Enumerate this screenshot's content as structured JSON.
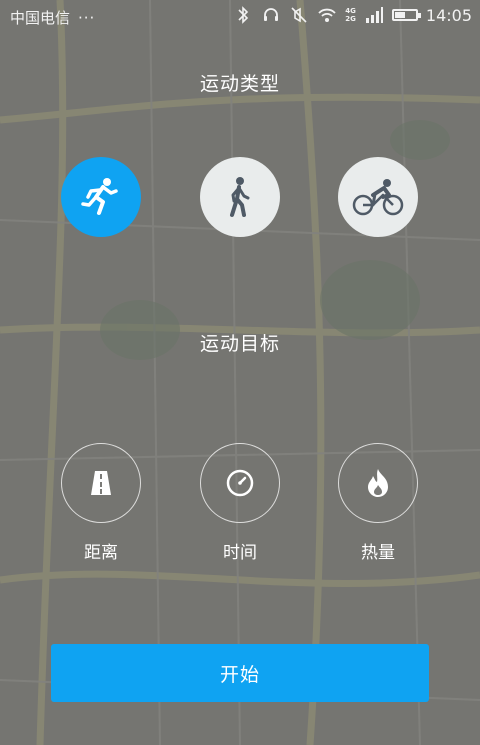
{
  "status_bar": {
    "carrier": "中国电信",
    "dots": "···",
    "network_top": "4G",
    "network_bottom": "2G",
    "time": "14:05",
    "battery_level": 0.55
  },
  "sport_type": {
    "title": "运动类型",
    "options": [
      {
        "icon": "running-icon",
        "selected": true
      },
      {
        "icon": "walking-icon",
        "selected": false
      },
      {
        "icon": "cycling-icon",
        "selected": false
      }
    ]
  },
  "sport_goal": {
    "title": "运动目标",
    "options": [
      {
        "icon": "road-icon",
        "label": "距离"
      },
      {
        "icon": "clock-icon",
        "label": "时间"
      },
      {
        "icon": "flame-icon",
        "label": "热量"
      }
    ]
  },
  "start_button": {
    "label": "开始"
  },
  "colors": {
    "accent": "#0fa3f2",
    "inactive_circle": "#e9ecec",
    "icon_dark": "#4f5a66"
  }
}
